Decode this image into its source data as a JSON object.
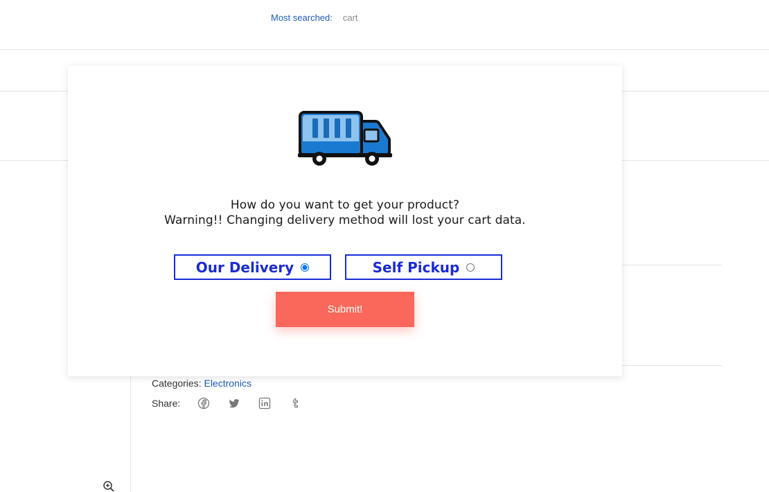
{
  "header": {
    "most_searched_label": "Most searched:",
    "most_searched_term": "cart"
  },
  "product_meta": {
    "categories_label": "Categories:",
    "category_link": "Electronics",
    "share_label": "Share:",
    "share_icons": [
      "facebook-icon",
      "twitter-icon",
      "linkedin-icon",
      "tumblr-icon"
    ]
  },
  "modal": {
    "icon": "delivery-truck-icon",
    "question": "How do you want to get your product?",
    "warning": "Warning!! Changing delivery method will lost your cart data.",
    "options": [
      {
        "label": "Our Delivery",
        "selected": true
      },
      {
        "label": "Self Pickup",
        "selected": false
      }
    ],
    "submit_label": "Submit!"
  },
  "colors": {
    "accent_blue": "#1a2bd6",
    "link_blue": "#1e5bb8",
    "submit_coral": "#f9685a",
    "truck_blue": "#1a7ad1"
  }
}
